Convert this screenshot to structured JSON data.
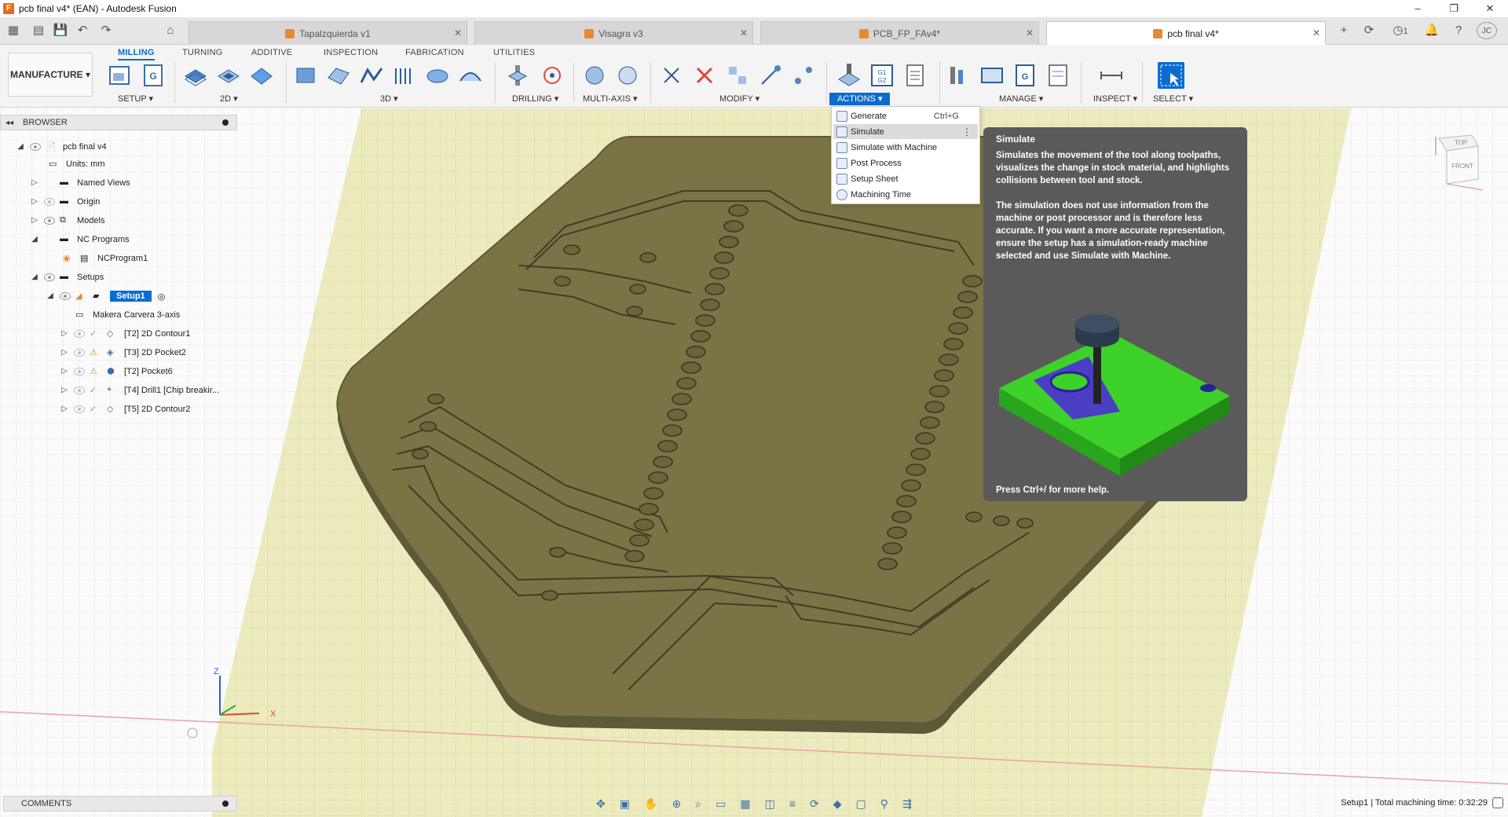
{
  "window": {
    "title": "pcb final v4* (EAN) - Autodesk Fusion",
    "controls": [
      "–",
      "❐",
      "✕"
    ]
  },
  "tabs": [
    {
      "label": "Tapalzquierda v1",
      "active": false
    },
    {
      "label": "Visagra v3",
      "active": false
    },
    {
      "label": "PCB_FP_FAv4*",
      "active": false
    },
    {
      "label": "pcb final v4*",
      "active": true
    }
  ],
  "tabbar_right": {
    "notifications": "1",
    "user_initials": "JC"
  },
  "toolbar": {
    "workspace": "MANUFACTURE ▾",
    "ribbon_tabs": [
      "MILLING",
      "TURNING",
      "ADDITIVE",
      "INSPECTION",
      "FABRICATION",
      "UTILITIES"
    ],
    "groups": [
      {
        "label": "SETUP ▾"
      },
      {
        "label": "2D ▾"
      },
      {
        "label": "3D ▾"
      },
      {
        "label": "DRILLING ▾"
      },
      {
        "label": "MULTI-AXIS ▾"
      },
      {
        "label": "MODIFY ▾"
      },
      {
        "label": "ACTIONS ▾"
      },
      {
        "label": "MANAGE ▾"
      },
      {
        "label": "INSPECT ▾"
      },
      {
        "label": "SELECT ▾"
      }
    ],
    "accent": "#0b6cd0"
  },
  "browser": {
    "title": "BROWSER",
    "items": [
      {
        "label": "pcb final v4"
      },
      {
        "label": "Units: mm"
      },
      {
        "label": "Named Views"
      },
      {
        "label": "Origin"
      },
      {
        "label": "Models"
      },
      {
        "label": "NC Programs"
      },
      {
        "label": "NCProgram1"
      },
      {
        "label": "Setups"
      },
      {
        "label": "Setup1"
      },
      {
        "label": "Makera Carvera 3-axis"
      },
      {
        "label": "[T2] 2D Contour1"
      },
      {
        "label": "[T3] 2D Pocket2"
      },
      {
        "label": "[T2] Pocket6"
      },
      {
        "label": "[T4] Drill1 [Chip breakir..."
      },
      {
        "label": "[T5] 2D Contour2"
      }
    ]
  },
  "actions_menu": {
    "items": [
      {
        "label": "Generate",
        "shortcut": "Ctrl+G"
      },
      {
        "label": "Simulate",
        "shortcut": "⋮"
      },
      {
        "label": "Simulate with Machine",
        "shortcut": ""
      },
      {
        "label": "Post Process",
        "shortcut": ""
      },
      {
        "label": "Setup Sheet",
        "shortcut": ""
      },
      {
        "label": "Machining Time",
        "shortcut": ""
      }
    ]
  },
  "tooltip": {
    "title": "Simulate",
    "body1": "Simulates the movement of the tool along toolpaths, visualizes the change in stock material, and highlights collisions between tool and stock.",
    "body2": "The simulation does not use information from the machine or post processor and is therefore less accurate. If you want a more accurate representation, ensure the setup has a simulation-ready machine selected and use Simulate with Machine.",
    "footer": "Press Ctrl+/ for more help."
  },
  "viewcube": {
    "top": "TOP",
    "front": "FRONT"
  },
  "axes": {
    "x": "X",
    "z": "Z"
  },
  "comments": {
    "label": "COMMENTS"
  },
  "status": {
    "text": "Setup1 | Total machining time: 0:32:29"
  }
}
